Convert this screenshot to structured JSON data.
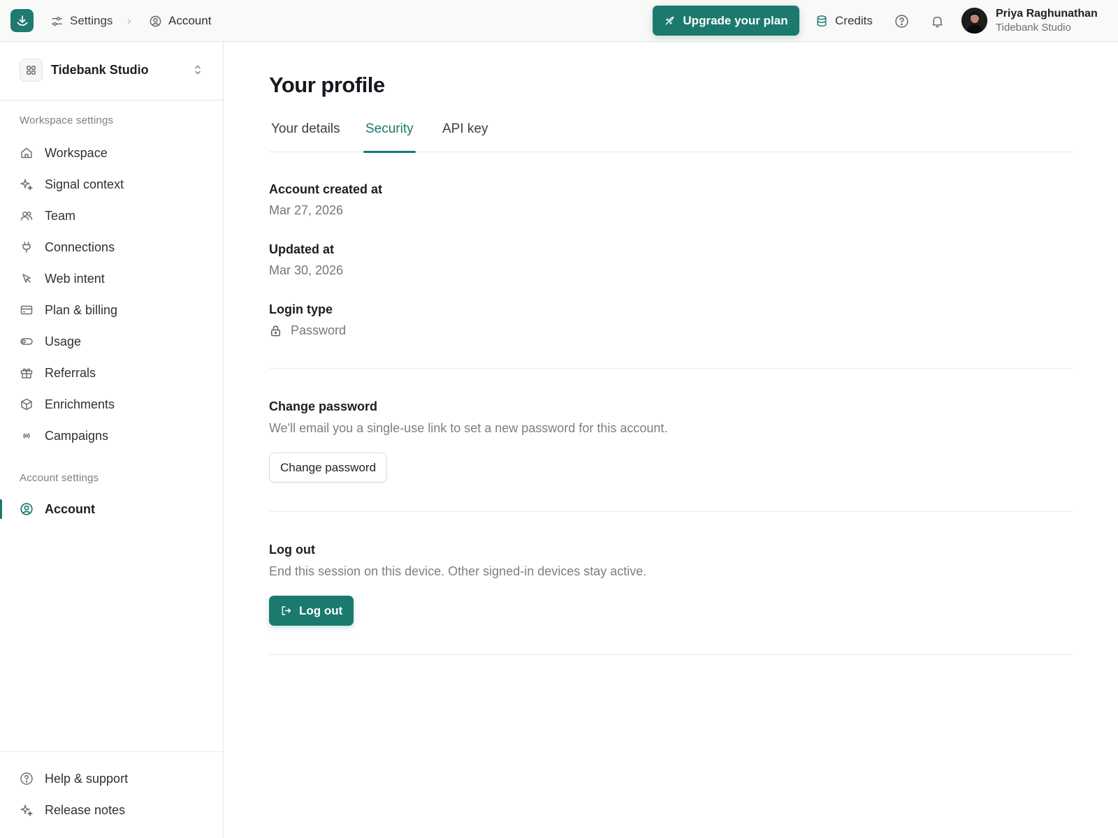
{
  "topbar": {
    "logo_icon": "app-logo-icon",
    "breadcrumb": {
      "settings_label": "Settings",
      "separator": "›",
      "account_label": "Account"
    },
    "upgrade_label": "Upgrade your plan",
    "credits_label": "Credits",
    "user": {
      "name": "Priya Raghunathan",
      "org": "Tidebank Studio"
    }
  },
  "sidebar": {
    "workspace_name": "Tidebank Studio",
    "workspace_section_label": "Workspace settings",
    "workspace_items": [
      {
        "label": "Workspace",
        "icon": "home-icon"
      },
      {
        "label": "Signal context",
        "icon": "sparkle-icon"
      },
      {
        "label": "Team",
        "icon": "users-icon"
      },
      {
        "label": "Connections",
        "icon": "plug-icon"
      },
      {
        "label": "Web intent",
        "icon": "cursor-icon"
      },
      {
        "label": "Plan & billing",
        "icon": "credit-card-icon"
      },
      {
        "label": "Usage",
        "icon": "toggle-icon"
      },
      {
        "label": "Referrals",
        "icon": "gift-icon"
      },
      {
        "label": "Enrichments",
        "icon": "cube-icon"
      },
      {
        "label": "Campaigns",
        "icon": "broadcast-icon"
      }
    ],
    "account_section_label": "Account settings",
    "account_items": [
      {
        "label": "Account",
        "icon": "user-circle-icon",
        "active": true
      }
    ],
    "footer_items": [
      {
        "label": "Help & support",
        "icon": "help-circle-icon"
      },
      {
        "label": "Release notes",
        "icon": "sparkle-icon"
      }
    ]
  },
  "main": {
    "title": "Your profile",
    "tabs": [
      {
        "label": "Your details",
        "active": false
      },
      {
        "label": "Security",
        "active": true
      },
      {
        "label": "API key",
        "active": false
      }
    ],
    "account_created": {
      "label": "Account created at",
      "value": "Mar 27, 2026"
    },
    "updated": {
      "label": "Updated at",
      "value": "Mar 30, 2026"
    },
    "login_type": {
      "label": "Login type",
      "value": "Password"
    },
    "change_password": {
      "heading": "Change password",
      "description": "We'll email you a single-use link to set a new password for this account.",
      "button_label": "Change password"
    },
    "logout": {
      "heading": "Log out",
      "description": "End this session on this device. Other signed-in devices stay active.",
      "button_label": "Log out"
    }
  },
  "colors": {
    "accent": "#1b7a6d",
    "topbar_bg": "#f9f9f8",
    "muted_text": "#72777d"
  }
}
